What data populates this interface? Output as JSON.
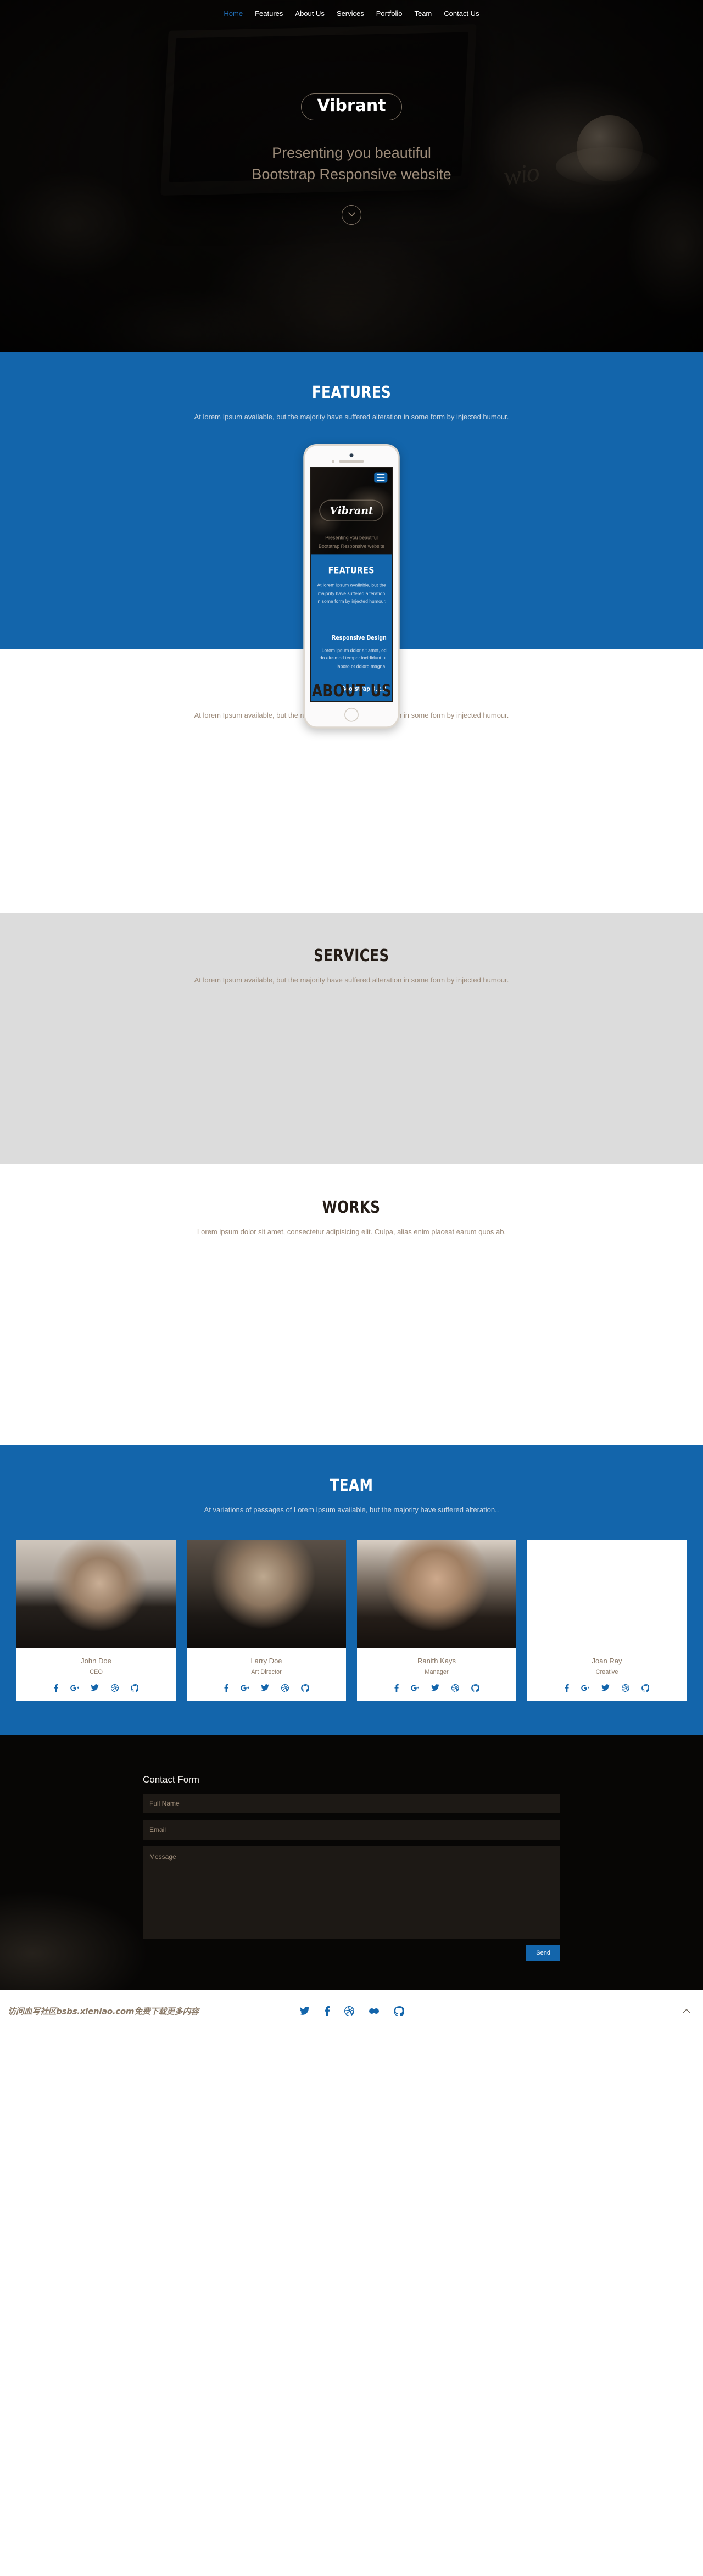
{
  "nav": {
    "items": [
      {
        "label": "Home",
        "active": true
      },
      {
        "label": "Features",
        "active": false
      },
      {
        "label": "About Us",
        "active": false
      },
      {
        "label": "Services",
        "active": false
      },
      {
        "label": "Portfolio",
        "active": false
      },
      {
        "label": "Team",
        "active": false
      },
      {
        "label": "Contact Us",
        "active": false
      }
    ]
  },
  "hero": {
    "logo": "Vibrant",
    "tagline_line1": "Presenting you beautiful",
    "tagline_line2": "Bootstrap Responsive website",
    "scroll_icon": "chevron-down-icon",
    "scroll_glyph": "⌄",
    "scribble": "wio"
  },
  "features": {
    "title": "FEATURES",
    "subtitle": "At lorem Ipsum available, but the majority have suffered alteration in some form by injected humour.",
    "phone": {
      "logo": "Vibrant",
      "tagline_line1": "Presenting you beautiful",
      "tagline_line2": "Bootstrap Responsive website",
      "title": "FEATURES",
      "subtitle": "At lorem Ipsum available, but the majority have suffered alteration in some form by injected humour.",
      "card_title": "Responsive Design",
      "card_text": "Lorem ipsum dolor sit amet, ed do eiusmod tempor incididunt ut labore et dolore magna.",
      "footer": "Bootstrap 3.2.2"
    }
  },
  "about": {
    "title": "ABOUT US",
    "subtitle": "At lorem Ipsum available, but the majority have suffered alteration in some form by injected humour."
  },
  "services": {
    "title": "SERVICES",
    "subtitle": "At lorem Ipsum available, but the majority have suffered alteration in some form by injected humour."
  },
  "works": {
    "title": "WORKS",
    "subtitle": "Lorem ipsum dolor sit amet, consectetur adipisicing elit. Culpa, alias enim placeat earum quos ab."
  },
  "team": {
    "title": "TEAM",
    "subtitle": "At variations of passages of Lorem Ipsum available, but the majority have suffered alteration..",
    "members": [
      {
        "name": "John Doe",
        "role": "CEO",
        "socials": [
          "facebook-icon",
          "google-plus-icon",
          "twitter-icon",
          "dribbble-icon",
          "github-icon"
        ]
      },
      {
        "name": "Larry Doe",
        "role": "Art Director",
        "socials": [
          "facebook-icon",
          "google-plus-icon",
          "twitter-icon",
          "dribbble-icon",
          "github-icon"
        ]
      },
      {
        "name": "Ranith Kays",
        "role": "Manager",
        "socials": [
          "facebook-icon",
          "google-plus-icon",
          "twitter-icon",
          "dribbble-icon",
          "github-icon"
        ]
      },
      {
        "name": "Joan Ray",
        "role": "Creative",
        "socials": [
          "facebook-icon",
          "google-plus-icon",
          "twitter-icon",
          "dribbble-icon",
          "github-icon"
        ]
      }
    ]
  },
  "contact": {
    "title": "Contact Form",
    "fullname_placeholder": "Full Name",
    "fullname_value": "",
    "email_placeholder": "Email",
    "email_value": "",
    "message_placeholder": "Message",
    "message_value": "",
    "send_label": "Send"
  },
  "footer": {
    "watermark": "访问血写社区bsbs.xienlao.com免费下载更多内容",
    "socials": [
      "twitter-icon",
      "facebook-icon",
      "dribbble-icon",
      "flickr-icon",
      "github-icon"
    ],
    "back_to_top_glyph": "⌃"
  },
  "colors": {
    "brand_blue": "#1365ab",
    "dark": "#050403",
    "gray": "#dcdcdc",
    "muted_brown": "#9b8978"
  }
}
